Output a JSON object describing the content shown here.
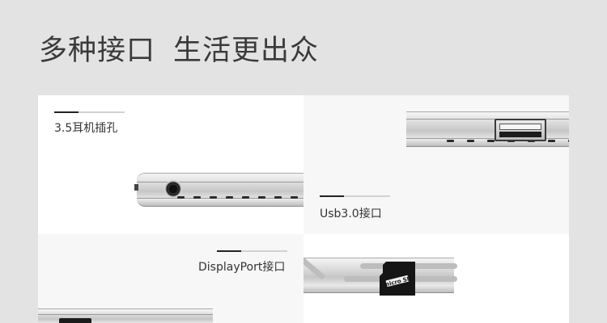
{
  "heading": {
    "part1": "多种接口",
    "part2": "生活更出众"
  },
  "panels": {
    "audio": {
      "label": "3.5耳机插孔"
    },
    "usb": {
      "label": "Usb3.0接口"
    },
    "displayport": {
      "label": "DisplayPort接口"
    },
    "card": {
      "card_logo": "micro SD"
    }
  },
  "colors": {
    "page_bg": "#e3e3e3",
    "panel_white": "#ffffff",
    "panel_light": "#f7f7f7",
    "accent_dark": "#222222"
  }
}
